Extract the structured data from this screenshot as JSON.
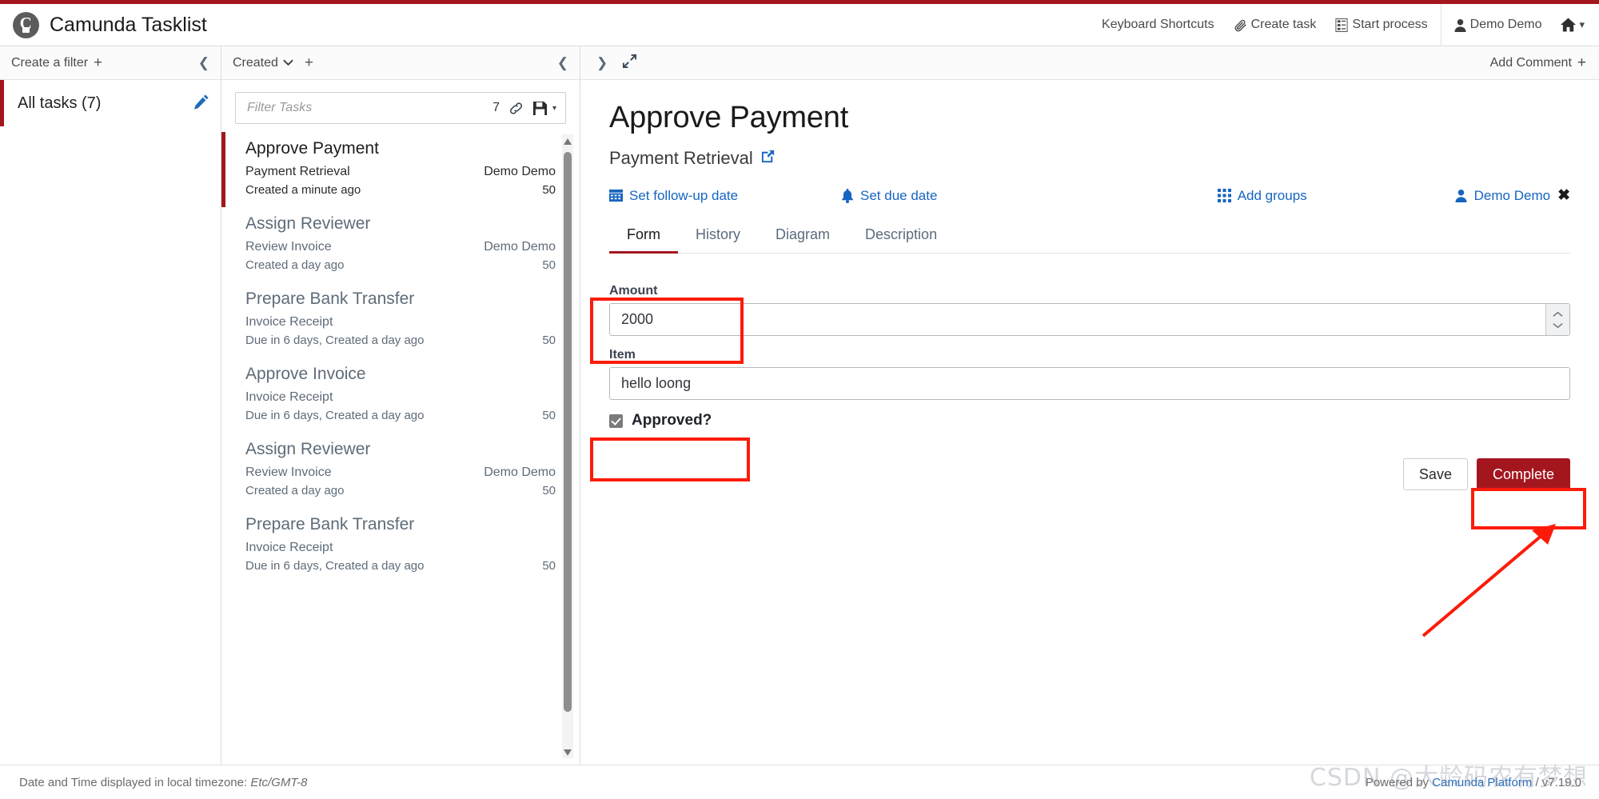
{
  "header": {
    "app_title": "Camunda Tasklist",
    "logo_icon": "camunda-logo-icon",
    "nav": [
      {
        "label": "Keyboard Shortcuts",
        "icon": null
      },
      {
        "label": "Create task",
        "icon": "paperclip-icon"
      },
      {
        "label": "Start process",
        "icon": "list-icon"
      }
    ],
    "user": {
      "label": "Demo Demo",
      "icon": "user-icon"
    },
    "home_icon": "home-icon",
    "home_caret": "▾"
  },
  "filters": {
    "create_label": "Create a filter",
    "create_plus": "+",
    "collapse_icon": "chevron-left-icon",
    "items": [
      {
        "label": "All tasks (7)",
        "edit_icon": "pencil-icon",
        "selected": true
      }
    ]
  },
  "tasklist": {
    "sort_label": "Created",
    "sort_caret": "⌄",
    "add_sort": "+",
    "collapse_icon": "chevron-left-icon",
    "search": {
      "placeholder": "Filter Tasks",
      "value": "",
      "count": "7",
      "link_icon": "chain-link-icon",
      "save_icon": "floppy-disk-icon",
      "save_caret": "▾"
    },
    "tasks": [
      {
        "title": "Approve Payment",
        "process": "Payment Retrieval",
        "assignee": "Demo Demo",
        "date": "Created a minute ago",
        "priority": "50",
        "selected": true
      },
      {
        "title": "Assign Reviewer",
        "process": "Review Invoice",
        "assignee": "Demo Demo",
        "date": "Created a day ago",
        "priority": "50",
        "selected": false
      },
      {
        "title": "Prepare Bank Transfer",
        "process": "Invoice Receipt",
        "assignee": "",
        "date": "Due in 6 days, Created a day ago",
        "priority": "50",
        "selected": false
      },
      {
        "title": "Approve Invoice",
        "process": "Invoice Receipt",
        "assignee": "",
        "date": "Due in 6 days, Created a day ago",
        "priority": "50",
        "selected": false
      },
      {
        "title": "Assign Reviewer",
        "process": "Review Invoice",
        "assignee": "Demo Demo",
        "date": "Created a day ago",
        "priority": "50",
        "selected": false
      },
      {
        "title": "Prepare Bank Transfer",
        "process": "Invoice Receipt",
        "assignee": "",
        "date": "Due in 6 days, Created a day ago",
        "priority": "50",
        "selected": false
      }
    ]
  },
  "detail": {
    "collapse_list_icon": "chevron-left-icon",
    "next_icon": "chevron-right-icon",
    "expand_icon": "expand-arrows-icon",
    "add_comment_label": "Add Comment",
    "add_comment_plus": "+",
    "title": "Approve Payment",
    "process_name": "Payment Retrieval",
    "process_link_icon": "external-link-icon",
    "actions": {
      "follow_up": {
        "label": "Set follow-up date",
        "icon": "calendar-icon"
      },
      "due_date": {
        "label": "Set due date",
        "icon": "bell-icon"
      },
      "add_groups": {
        "label": "Add groups",
        "icon": "grid-icon"
      },
      "assignee": {
        "label": "Demo Demo",
        "icon": "user-icon",
        "remove": "✖"
      }
    },
    "tabs": [
      {
        "label": "Form",
        "active": true
      },
      {
        "label": "History",
        "active": false
      },
      {
        "label": "Diagram",
        "active": false
      },
      {
        "label": "Description",
        "active": false
      }
    ],
    "form": {
      "amount": {
        "label": "Amount",
        "value": "2000",
        "spinner_up": "⌃",
        "spinner_down": "⌄"
      },
      "item": {
        "label": "Item",
        "value": "hello loong"
      },
      "approved": {
        "label": "Approved?",
        "checked": true
      }
    },
    "buttons": {
      "save": "Save",
      "complete": "Complete"
    }
  },
  "footer": {
    "timezone_prefix": "Date and Time displayed in local timezone:",
    "timezone": "Etc/GMT-8",
    "powered_by": "Powered by",
    "platform": "Camunda Platform",
    "version": "/ v7.19.0",
    "watermark": "CSDN @大龄码农有梦想"
  },
  "colors": {
    "brand_red": "#a4161e",
    "link_blue": "#1665c0",
    "annotation_red": "#fc1b0a"
  }
}
